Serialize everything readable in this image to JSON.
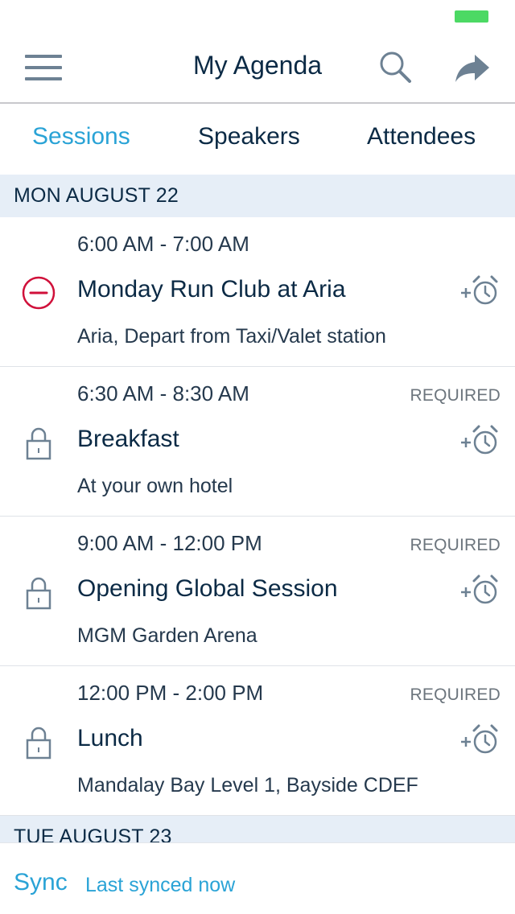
{
  "navbar": {
    "title": "My Agenda",
    "menu_icon": "hamburger-menu-icon",
    "search_icon": "search-icon",
    "share_icon": "share-arrow-icon"
  },
  "tabs": [
    {
      "label": "Sessions",
      "active": true
    },
    {
      "label": "Speakers",
      "active": false
    },
    {
      "label": "Attendees",
      "active": false
    }
  ],
  "days": [
    {
      "label": "MON AUGUST 22",
      "sessions": [
        {
          "time": "6:00 AM - 7:00 AM",
          "badge": "",
          "title": "Monday Run Club at Aria",
          "location": "Aria, Depart from Taxi/Valet station",
          "icon": "remove-circle-icon"
        },
        {
          "time": "6:30 AM - 8:30 AM",
          "badge": "REQUIRED",
          "title": "Breakfast",
          "location": "At your own hotel",
          "icon": "lock-icon"
        },
        {
          "time": "9:00 AM - 12:00 PM",
          "badge": "REQUIRED",
          "title": "Opening Global Session",
          "location": "MGM Garden Arena",
          "icon": "lock-icon"
        },
        {
          "time": "12:00 PM - 2:00 PM",
          "badge": "REQUIRED",
          "title": "Lunch",
          "location": "Mandalay Bay Level 1, Bayside CDEF",
          "icon": "lock-icon"
        }
      ]
    },
    {
      "label": "TUE AUGUST 23",
      "sessions": []
    }
  ],
  "footer": {
    "sync_label": "Sync",
    "sync_status": "Last synced now"
  },
  "colors": {
    "accent": "#2aa3d6",
    "remove": "#d0103a",
    "icon_gray": "#6d8193",
    "header_bg": "#e6eef7",
    "battery": "#4cd964"
  }
}
